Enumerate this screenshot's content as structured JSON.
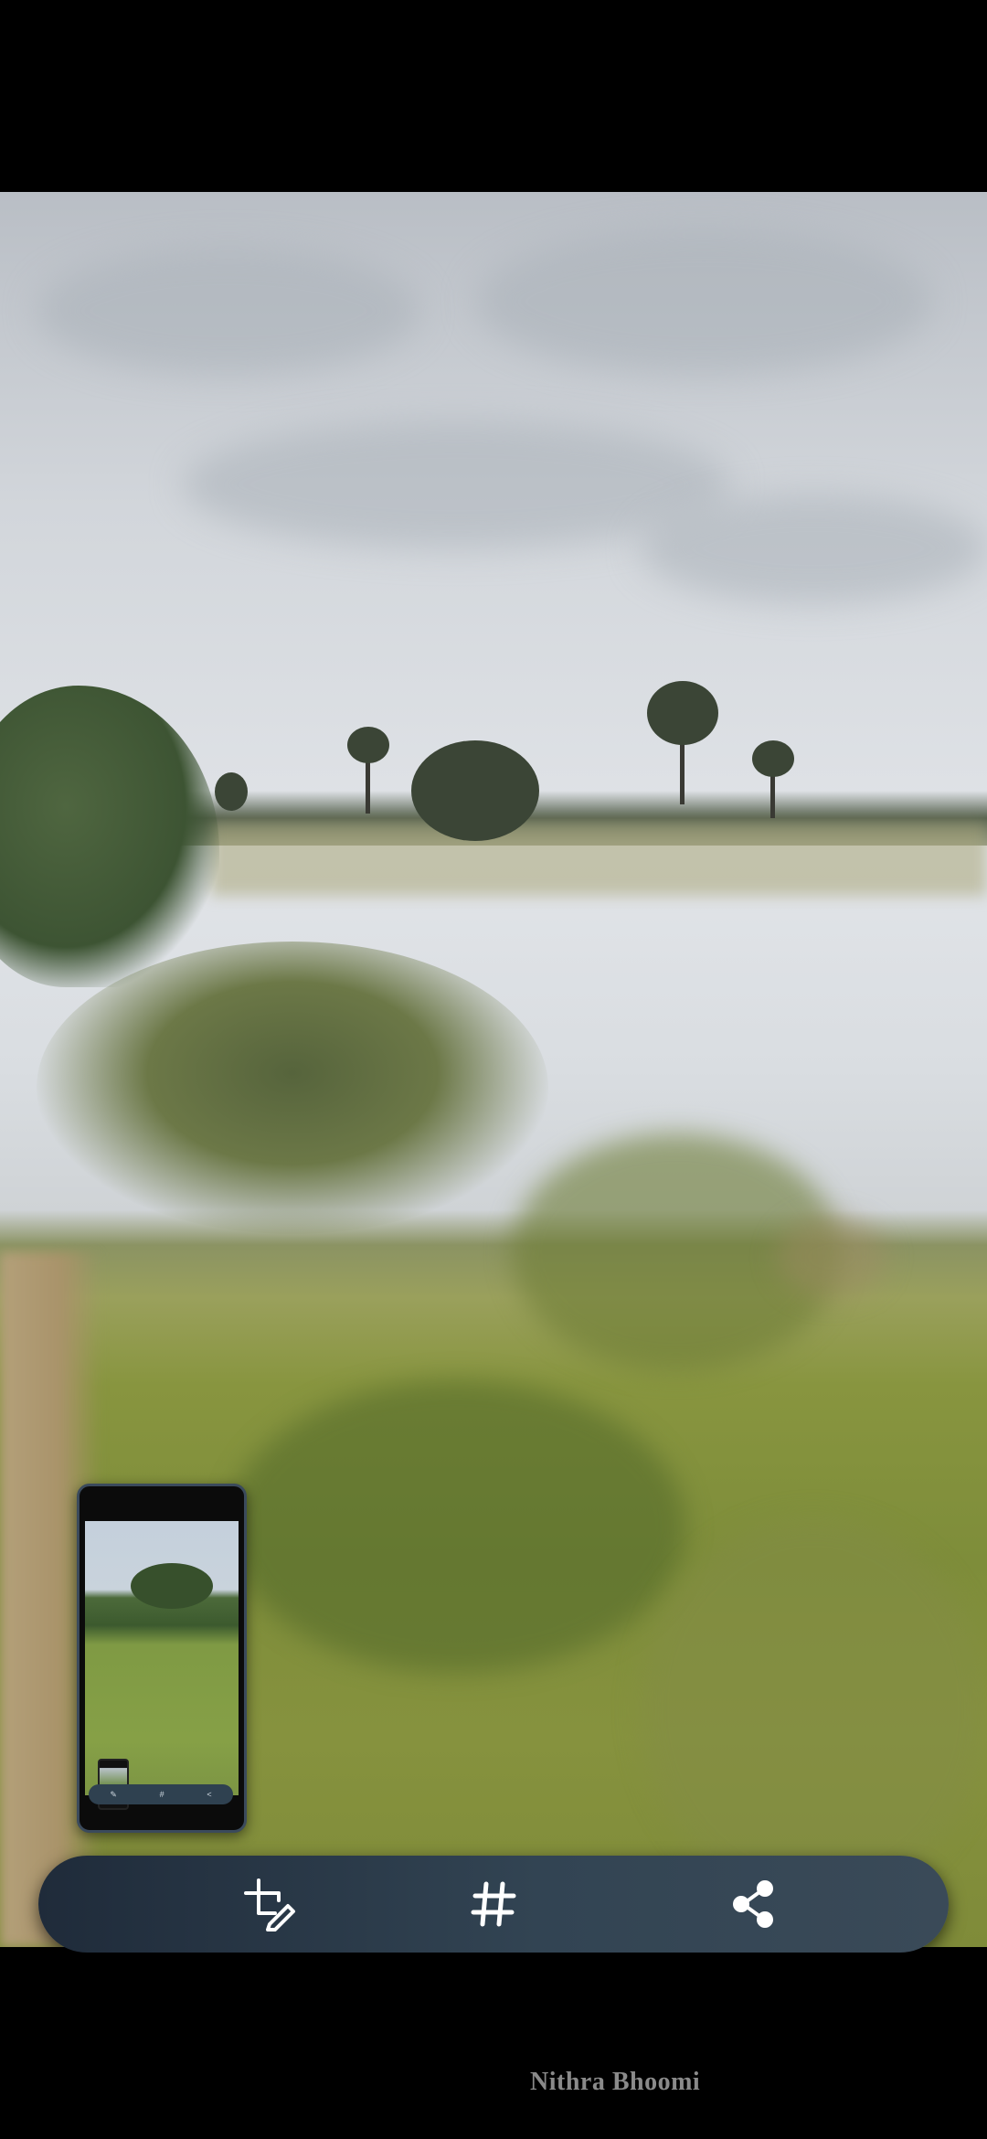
{
  "screen": {
    "type": "screenshot-preview"
  },
  "toolbar": {
    "buttons": [
      {
        "name": "edit",
        "icon": "crop-edit-icon"
      },
      {
        "name": "hashtag",
        "icon": "hashtag-icon",
        "glyph": "#"
      },
      {
        "name": "share",
        "icon": "share-icon"
      }
    ]
  },
  "watermark": {
    "text": "Nithra Bhoomi"
  },
  "colors": {
    "toolbar_bg": "#2a3a48",
    "icon": "#ffffff",
    "thumbnail_border": "#3b4a5c",
    "watermark": "#8a8a8a"
  }
}
